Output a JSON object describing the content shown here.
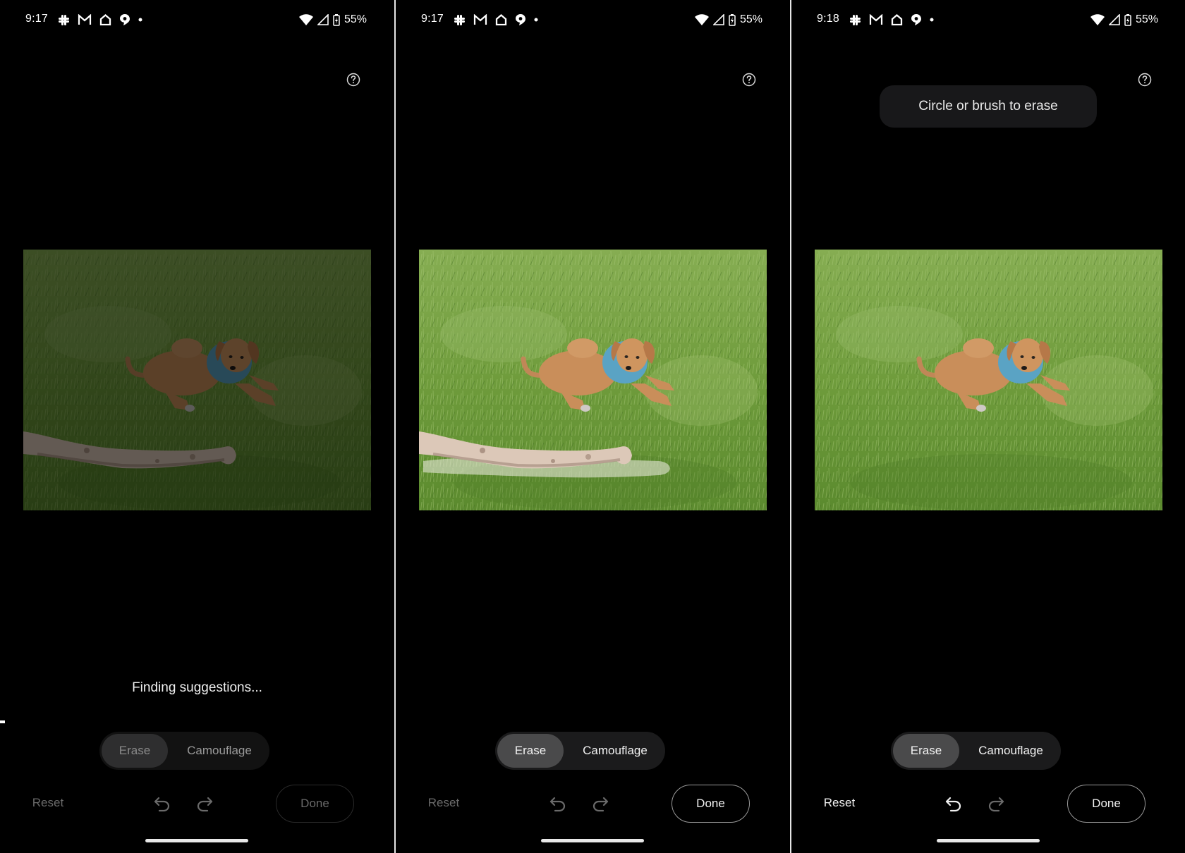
{
  "panels": [
    {
      "status": {
        "time": "9:17",
        "battery": "55%",
        "notification_icons": [
          "slack-icon",
          "gmail-icon",
          "home-icon",
          "maps-icon",
          "more-dot-icon"
        ],
        "system_icons": [
          "wifi-icon",
          "signal-icon",
          "battery-charging-icon"
        ]
      },
      "state": "loading",
      "message": "Finding suggestions...",
      "modes": {
        "erase": "Erase",
        "camouflage": "Camouflage",
        "selected": "Erase"
      },
      "actions": {
        "reset": "Reset",
        "done": "Done",
        "reset_enabled": false,
        "undo_enabled": false,
        "redo_enabled": false,
        "done_enabled": false
      },
      "photo": {
        "subject": "puppy-in-grass",
        "stick_visible": true,
        "dimmed": true,
        "stick_highlighted": false
      }
    },
    {
      "status": {
        "time": "9:17",
        "battery": "55%",
        "notification_icons": [
          "slack-icon",
          "gmail-icon",
          "home-icon",
          "maps-icon",
          "more-dot-icon"
        ],
        "system_icons": [
          "wifi-icon",
          "signal-icon",
          "battery-charging-icon"
        ]
      },
      "state": "suggestion-highlighted",
      "modes": {
        "erase": "Erase",
        "camouflage": "Camouflage",
        "selected": "Erase"
      },
      "actions": {
        "reset": "Reset",
        "done": "Done",
        "reset_enabled": false,
        "undo_enabled": false,
        "redo_enabled": false,
        "done_enabled": true
      },
      "photo": {
        "subject": "puppy-in-grass",
        "stick_visible": true,
        "dimmed": false,
        "stick_highlighted": true
      }
    },
    {
      "status": {
        "time": "9:18",
        "battery": "55%",
        "notification_icons": [
          "slack-icon",
          "gmail-icon",
          "home-icon",
          "maps-icon",
          "more-dot-icon"
        ],
        "system_icons": [
          "wifi-icon",
          "signal-icon",
          "battery-charging-icon"
        ]
      },
      "state": "erased",
      "tooltip": "Circle or brush to erase",
      "modes": {
        "erase": "Erase",
        "camouflage": "Camouflage",
        "selected": "Erase"
      },
      "actions": {
        "reset": "Reset",
        "done": "Done",
        "reset_enabled": true,
        "undo_enabled": true,
        "redo_enabled": false,
        "done_enabled": true
      },
      "photo": {
        "subject": "puppy-in-grass",
        "stick_visible": false,
        "dimmed": false,
        "stick_highlighted": false
      }
    }
  ],
  "colors": {
    "background": "#000000",
    "segment_bg": "#1b1b1c",
    "segment_selected": "#4a4a4b",
    "tooltip_bg": "#18181a",
    "disabled_text": "#6a6a6a",
    "grass": "#6b9a3a",
    "dog": "#c98e5a",
    "harness": "#5aa3c4",
    "stick": "#d9c4b4"
  }
}
